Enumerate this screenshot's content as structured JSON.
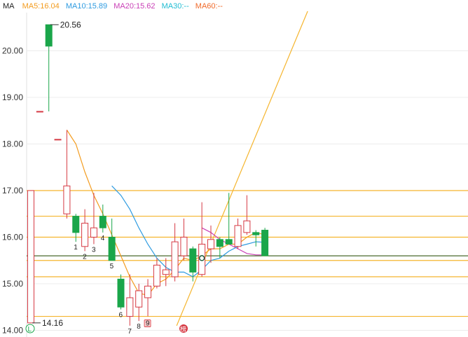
{
  "header": {
    "label": "MA",
    "ma5": "MA5:16.04",
    "ma10": "MA10:15.89",
    "ma20": "MA20:15.62",
    "ma30": "MA30:--",
    "ma60": "MA60:--"
  },
  "colors": {
    "up": "#d63a44",
    "down": "#1aa64a",
    "ma5": "#f39c1f",
    "ma10": "#2e9be0",
    "ma20": "#c93fb6",
    "ma30": "#1fbcd2",
    "ma60": "#f06a2a",
    "hline": "#f5b52e",
    "trend": "#f5b52e"
  },
  "badges": {
    "circle_l": "L",
    "tag": "榜",
    "marker9": "9"
  },
  "chart_data": {
    "type": "candlestick",
    "title": "",
    "ylim": [
      13.9,
      20.65
    ],
    "yticks": [
      "20.00",
      "19.00",
      "18.00",
      "17.00",
      "16.00",
      "15.00",
      "14.00"
    ],
    "ytick_values": [
      20,
      19,
      18,
      17,
      16,
      15,
      14
    ],
    "candles": [
      {
        "o": 14.16,
        "h": 17.0,
        "l": 14.16,
        "c": 17.0
      },
      {
        "o": 18.7,
        "h": 18.7,
        "l": 18.7,
        "c": 18.7
      },
      {
        "o": 20.56,
        "h": 20.56,
        "l": 18.7,
        "c": 20.1
      },
      {
        "o": 18.1,
        "h": 18.1,
        "l": 18.1,
        "c": 18.1
      },
      {
        "o": 16.5,
        "h": 18.3,
        "l": 16.4,
        "c": 17.1
      },
      {
        "o": 16.45,
        "h": 16.5,
        "l": 15.9,
        "c": 16.1
      },
      {
        "o": 15.8,
        "h": 16.6,
        "l": 15.7,
        "c": 16.3
      },
      {
        "o": 16.0,
        "h": 16.95,
        "l": 15.85,
        "c": 16.2
      },
      {
        "o": 16.45,
        "h": 16.7,
        "l": 16.1,
        "c": 16.2
      },
      {
        "o": 16.0,
        "h": 16.4,
        "l": 15.5,
        "c": 15.5
      },
      {
        "o": 15.1,
        "h": 15.2,
        "l": 14.45,
        "c": 14.5
      },
      {
        "o": 14.3,
        "h": 15.2,
        "l": 14.1,
        "c": 14.7
      },
      {
        "o": 14.5,
        "h": 15.0,
        "l": 14.2,
        "c": 14.85
      },
      {
        "o": 14.7,
        "h": 15.1,
        "l": 14.3,
        "c": 14.95
      },
      {
        "o": 14.95,
        "h": 15.55,
        "l": 14.9,
        "c": 15.4
      },
      {
        "o": 15.2,
        "h": 15.55,
        "l": 14.95,
        "c": 15.3
      },
      {
        "o": 15.15,
        "h": 16.3,
        "l": 15.05,
        "c": 15.9
      },
      {
        "o": 15.6,
        "h": 16.4,
        "l": 15.5,
        "c": 16.0
      },
      {
        "o": 15.75,
        "h": 15.8,
        "l": 15.05,
        "c": 15.25
      },
      {
        "o": 15.2,
        "h": 16.75,
        "l": 15.15,
        "c": 15.85
      },
      {
        "o": 15.75,
        "h": 16.25,
        "l": 15.45,
        "c": 15.95
      },
      {
        "o": 15.95,
        "h": 16.0,
        "l": 15.55,
        "c": 15.8
      },
      {
        "o": 15.95,
        "h": 16.95,
        "l": 15.85,
        "c": 15.85
      },
      {
        "o": 15.8,
        "h": 16.4,
        "l": 15.75,
        "c": 16.25
      },
      {
        "o": 16.1,
        "h": 16.9,
        "l": 16.05,
        "c": 16.35
      },
      {
        "o": 16.1,
        "h": 16.15,
        "l": 15.8,
        "c": 16.05
      },
      {
        "o": 16.15,
        "h": 16.2,
        "l": 15.6,
        "c": 15.6
      }
    ],
    "ma5": [
      null,
      null,
      null,
      null,
      18.3,
      18.0,
      17.4,
      16.9,
      16.5,
      16.05,
      15.6,
      15.15,
      14.8,
      14.75,
      15.0,
      15.1,
      15.3,
      15.55,
      15.5,
      15.6,
      15.75,
      15.75,
      15.85,
      15.85,
      16.0,
      16.1,
      16.05
    ],
    "ma10": [
      null,
      null,
      null,
      null,
      null,
      null,
      null,
      null,
      null,
      17.1,
      16.9,
      16.6,
      16.2,
      15.85,
      15.55,
      15.35,
      15.25,
      15.25,
      15.15,
      15.3,
      15.5,
      15.55,
      15.7,
      15.8,
      15.85,
      15.9,
      15.89
    ],
    "ma20": [
      null,
      null,
      null,
      null,
      null,
      null,
      null,
      null,
      null,
      null,
      null,
      null,
      null,
      null,
      null,
      null,
      null,
      null,
      null,
      16.2,
      16.1,
      15.95,
      15.85,
      15.75,
      15.65,
      15.62,
      15.62
    ],
    "h_levels": [
      17.0,
      16.45,
      16.0,
      15.6,
      15.5,
      15.15,
      14.3
    ],
    "current_price": 15.6,
    "trend_from": [
      14.1,
      16.2
    ],
    "trend_to": [
      20.85,
      30.75
    ],
    "max_label": "20.56",
    "min_label": "14.16",
    "wave_labels": [
      {
        "i": 5,
        "text": "1"
      },
      {
        "i": 6,
        "text": "2"
      },
      {
        "i": 7,
        "text": "3"
      },
      {
        "i": 8,
        "text": "4"
      },
      {
        "i": 9,
        "text": "5"
      },
      {
        "i": 10,
        "text": "6"
      },
      {
        "i": 11,
        "text": "7"
      },
      {
        "i": 12,
        "text": "8"
      }
    ]
  }
}
